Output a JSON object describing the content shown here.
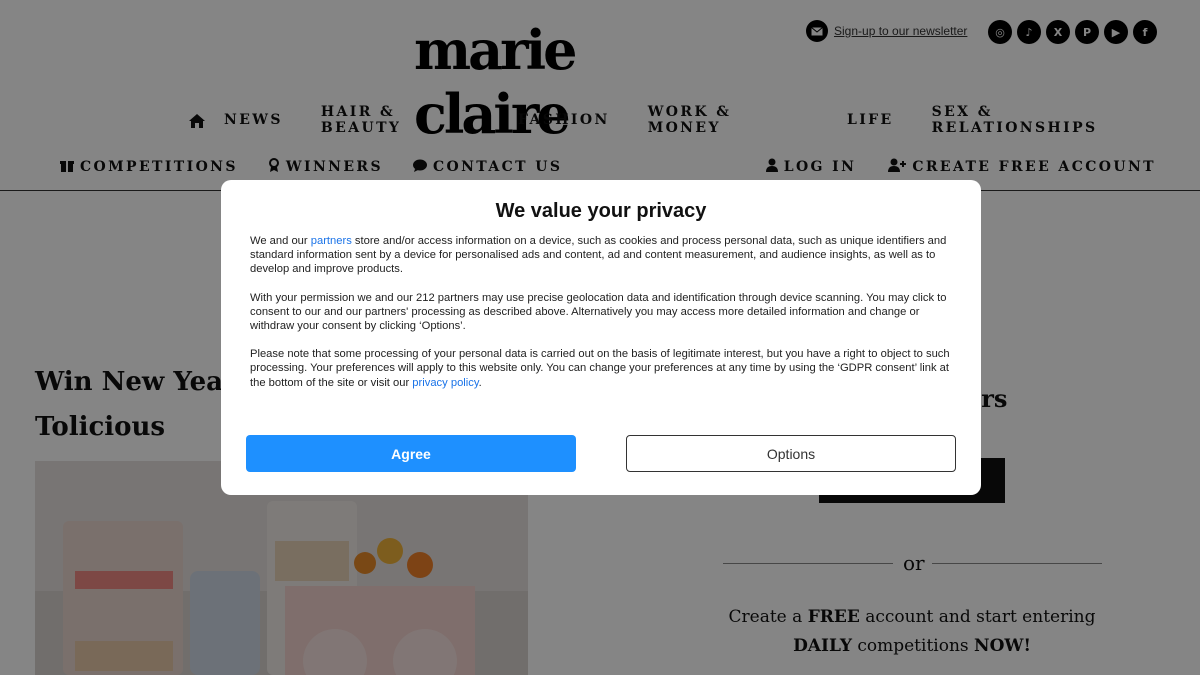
{
  "header": {
    "logo": "marie claire",
    "newsletter_link": "Sign-up to our newsletter",
    "social_icons": [
      "instagram-icon",
      "tiktok-icon",
      "x-icon",
      "pinterest-icon",
      "youtube-icon",
      "facebook-icon"
    ]
  },
  "nav_main": [
    "NEWS",
    "HAIR & BEAUTY",
    "FASHION",
    "WORK & MONEY",
    "LIFE",
    "SEX & RELATIONSHIPS"
  ],
  "nav_secondary": {
    "competitions": "COMPETITIONS",
    "winners": "WINNERS",
    "contact": "CONTACT US",
    "login": "LOG IN",
    "create_account": "CREATE FREE ACCOUNT"
  },
  "article": {
    "title_line1": "Win New Year I",
    "title_line2": "Tolicious"
  },
  "sidebar": {
    "partial_heading": "ers",
    "or": "or",
    "cta_1": "Create a ",
    "cta_free": "FREE",
    "cta_2": " account and start entering ",
    "cta_daily": "DAILY",
    "cta_3": " competitions ",
    "cta_now": "NOW!"
  },
  "consent": {
    "title": "We value your privacy",
    "p1_a": "We and our ",
    "p1_link": "partners",
    "p1_b": " store and/or access information on a device, such as cookies and process personal data, such as unique identifiers and standard information sent by a device for personalised ads and content, ad and content measurement, and audience insights, as well as to develop and improve products.",
    "p2": "With your permission we and our 212 partners may use precise geolocation data and identification through device scanning. You may click to consent to our and our partners' processing as described above. Alternatively you may access more detailed information and change or withdraw your consent by clicking ‘Options’.",
    "p3_a": "Please note that some processing of your personal data is carried out on the basis of legitimate interest, but you have a right to object to such processing. Your preferences will apply to this website only. You can change your preferences at any time by using the ‘GDPR consent’ link at the bottom of the site or visit our ",
    "p3_link": "privacy policy",
    "p3_b": ".",
    "agree": "Agree",
    "options": "Options"
  }
}
